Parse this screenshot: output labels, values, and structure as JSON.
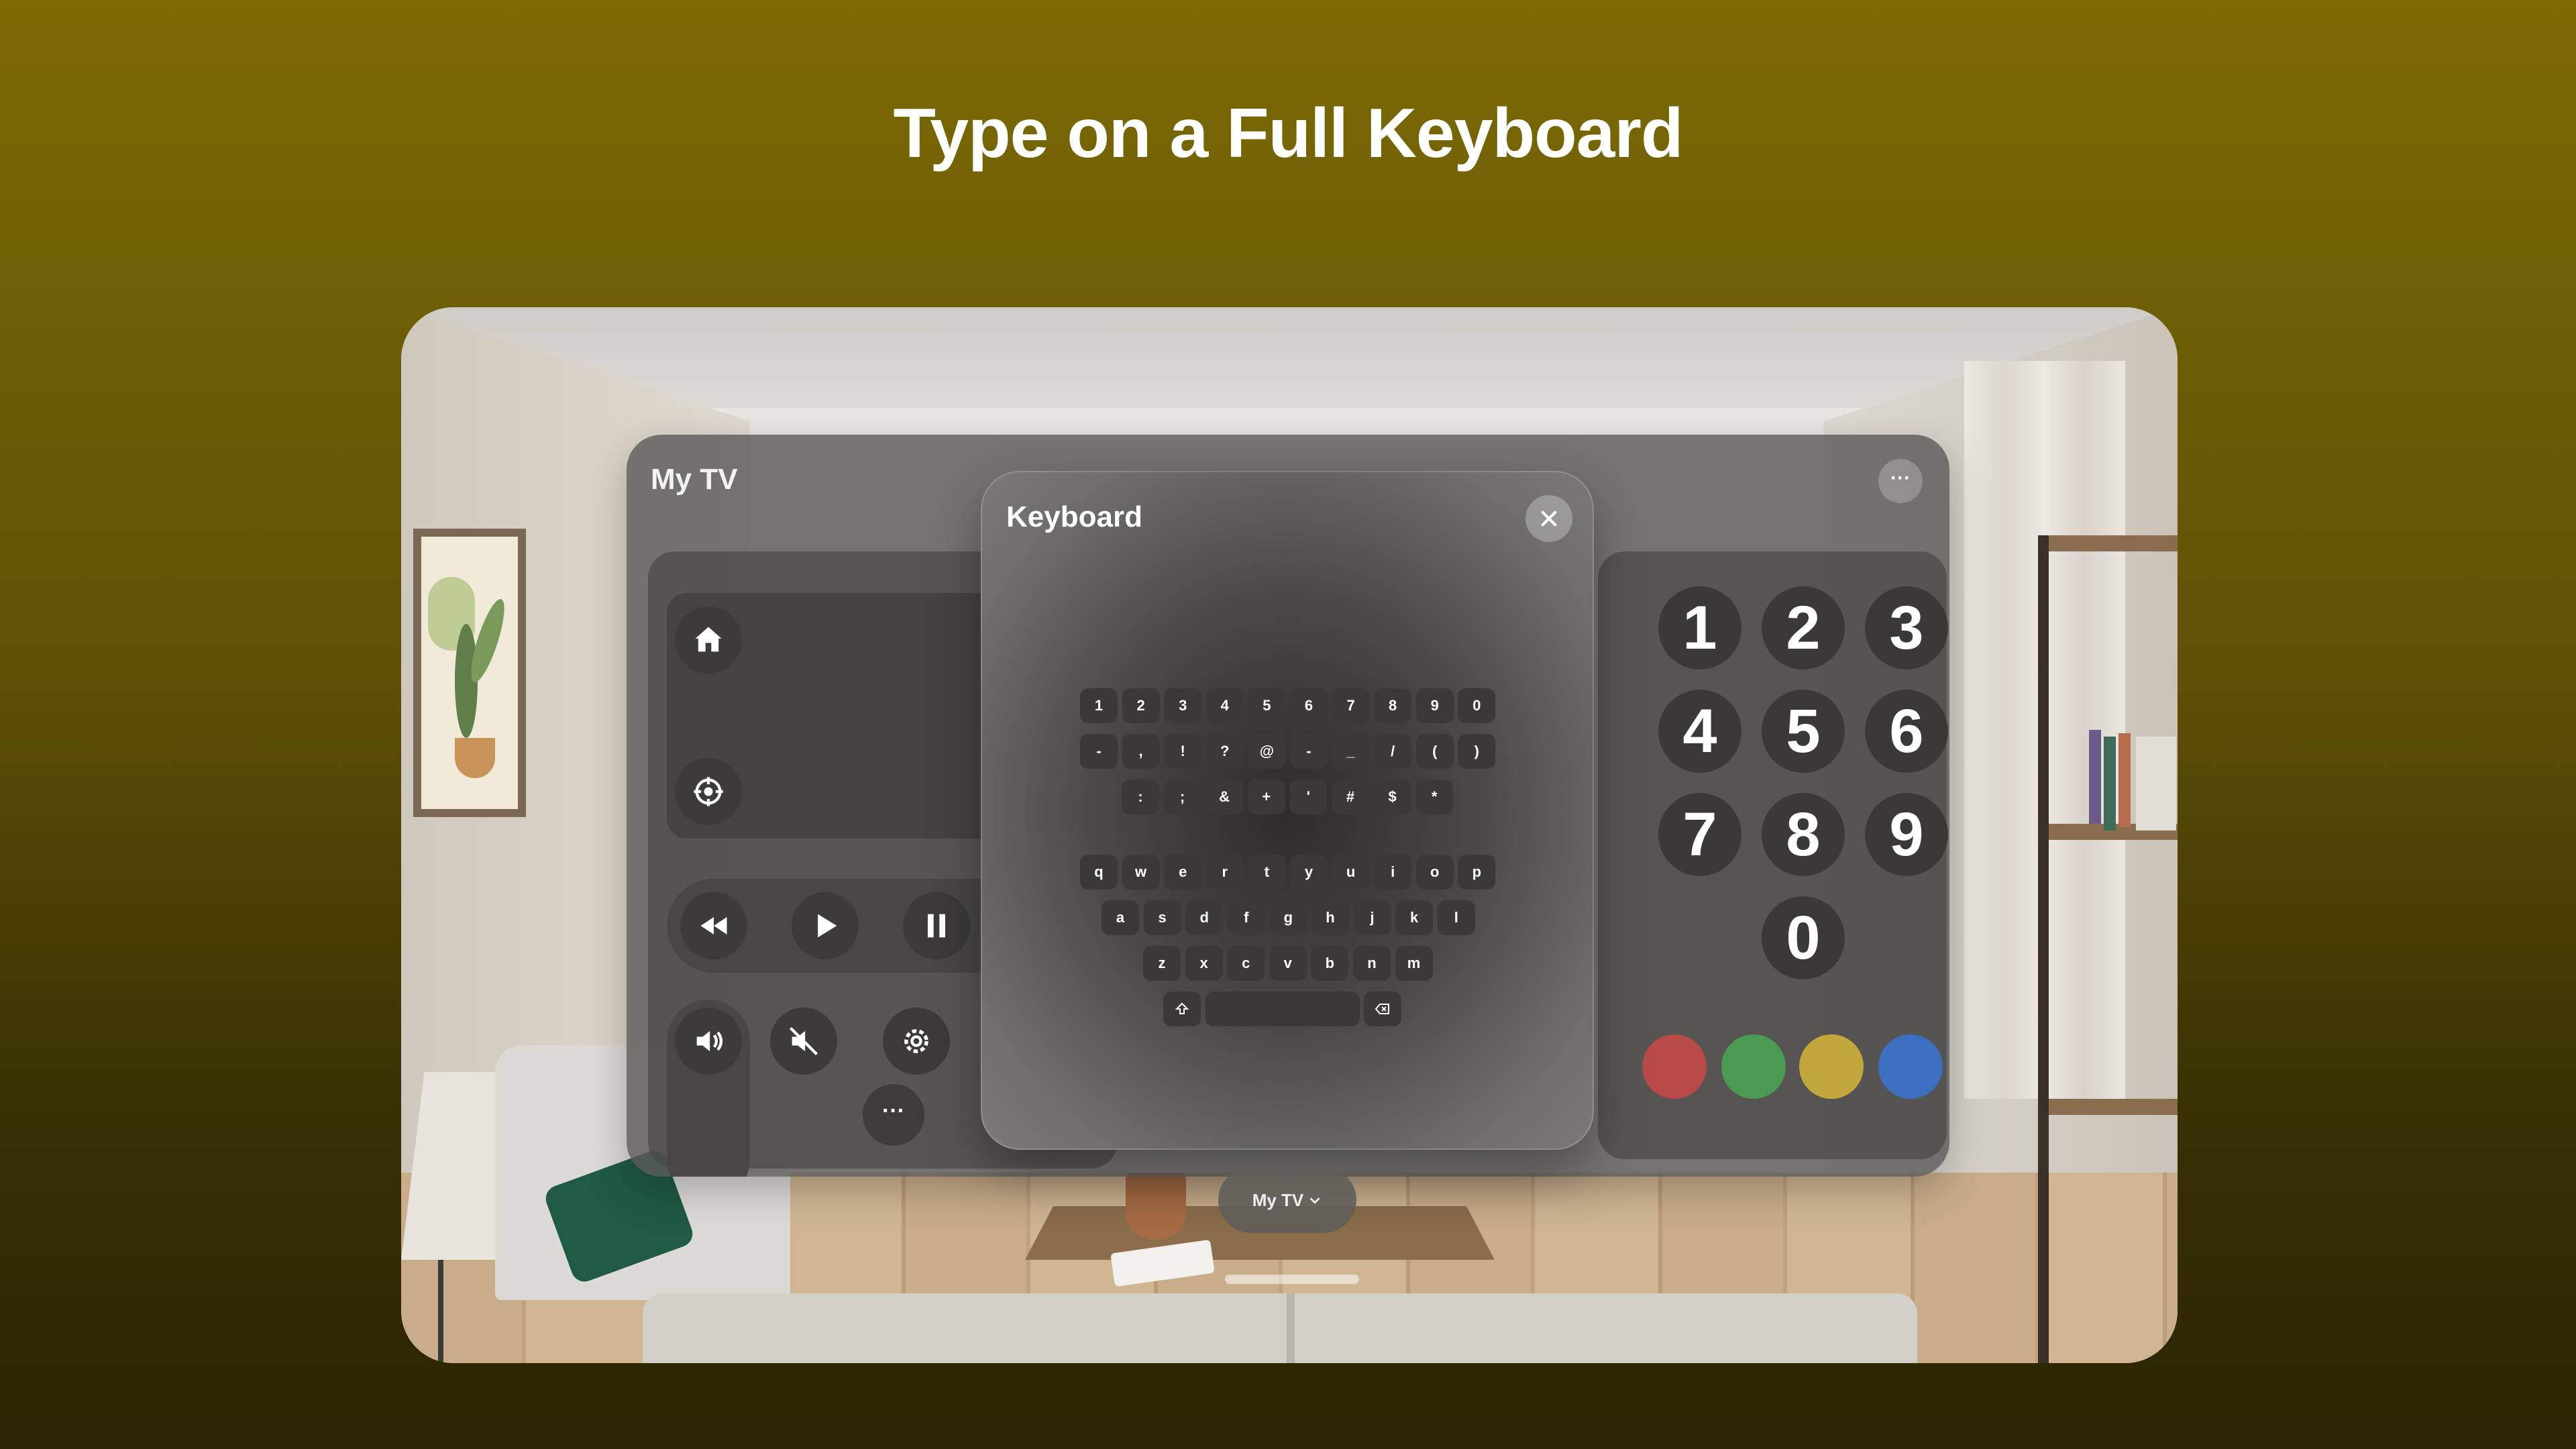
{
  "headline": "Type on a Full Keyboard",
  "window": {
    "title": "My TV",
    "more_label": "···"
  },
  "keyboard": {
    "title": "Keyboard",
    "rows": [
      [
        "1",
        "2",
        "3",
        "4",
        "5",
        "6",
        "7",
        "8",
        "9",
        "0"
      ],
      [
        "-",
        ",",
        "!",
        "?",
        "@",
        "-",
        "_",
        "/",
        "(",
        ")"
      ],
      [
        ":",
        ";",
        "&",
        "+",
        "'",
        "#",
        "$",
        "*"
      ],
      [
        "q",
        "w",
        "e",
        "r",
        "t",
        "y",
        "u",
        "i",
        "o",
        "p"
      ],
      [
        "a",
        "s",
        "d",
        "f",
        "g",
        "h",
        "j",
        "k",
        "l"
      ],
      [
        "z",
        "x",
        "c",
        "v",
        "b",
        "n",
        "m"
      ]
    ],
    "shift_icon": "shift-icon",
    "delete_icon": "delete-icon",
    "space_label": ""
  },
  "numpad": {
    "keys": [
      "1",
      "2",
      "3",
      "4",
      "5",
      "6",
      "7",
      "8",
      "9",
      "0"
    ]
  },
  "color_buttons": [
    "#b84a4a",
    "#4a9a52",
    "#c2a83c",
    "#3c6fbf"
  ],
  "device_switcher": {
    "label": "My TV",
    "chevron_icon": "chevron-down-icon"
  },
  "more_small_label": "···"
}
